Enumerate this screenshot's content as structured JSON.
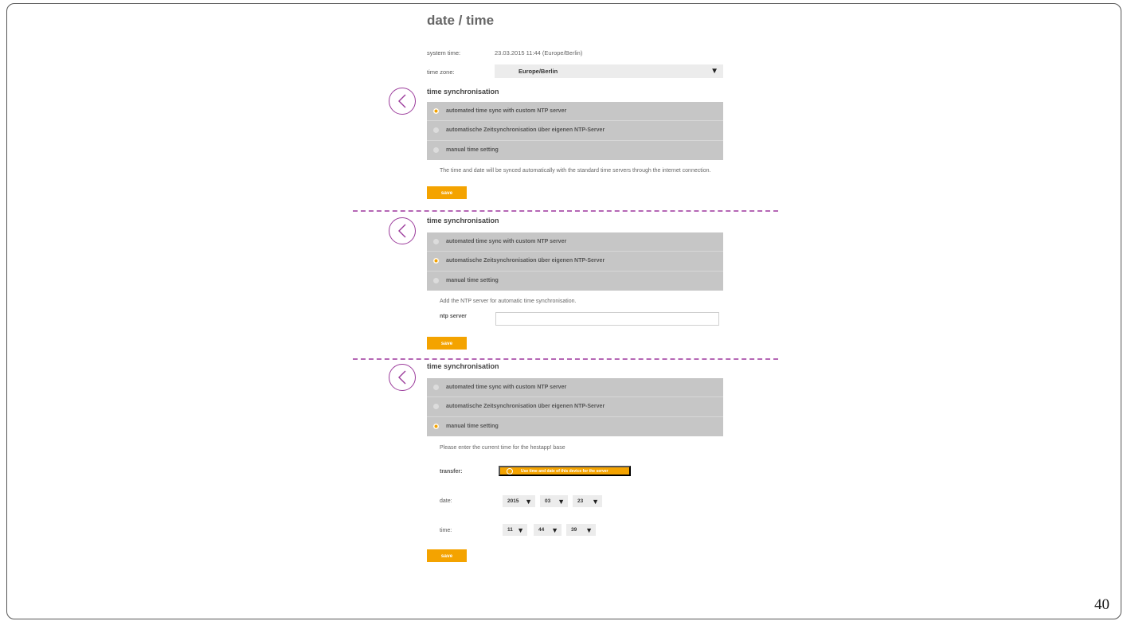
{
  "page": {
    "title": "date / time",
    "page_number": "40"
  },
  "system": {
    "system_time_label": "system time:",
    "system_time_value": "23.03.2015 11:44 (Europe/Berlin)",
    "timezone_label": "time zone:",
    "timezone_value": "Europe/Berlin"
  },
  "section_title": "time synchronisation",
  "options": [
    "automated time sync with custom NTP server",
    "automatische Zeitsynchronisation über eigenen NTP-Server",
    "manual time setting"
  ],
  "panel1": {
    "selected_index": 0,
    "note": "The time and date will be synced automatically with the standard time servers through the internet connection.",
    "save_label": "save"
  },
  "panel2": {
    "selected_index": 1,
    "note": "Add the NTP server for automatic time synchronisation.",
    "ntp_label": "ntp server",
    "ntp_value": "",
    "save_label": "save"
  },
  "panel3": {
    "selected_index": 2,
    "note": "Please enter the current time for the hestapp! base",
    "transfer_label": "transfer:",
    "transfer_button": "Use time and date of this device for the server",
    "date_label": "date:",
    "date": {
      "year": "2015",
      "month": "03",
      "day": "23"
    },
    "time_label": "time:",
    "time": {
      "hour": "11",
      "minute": "44",
      "second": "39"
    },
    "save_label": "save"
  },
  "colors": {
    "accent": "#f4a300",
    "divider": "#b567b5",
    "back_button": "#9b3b9b",
    "option_bg": "#c6c6c6"
  },
  "icons": {
    "back": "chevron-left-icon",
    "dropdown": "triangle-down-icon"
  }
}
